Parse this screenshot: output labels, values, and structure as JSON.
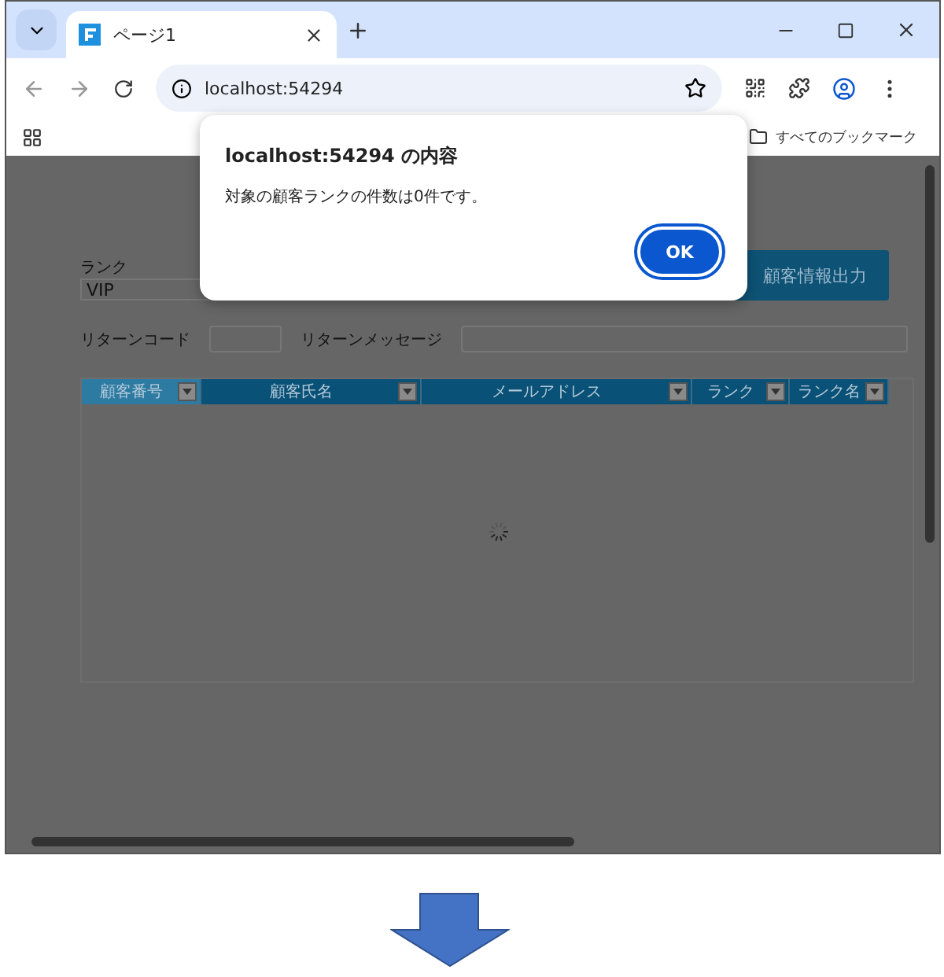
{
  "browser": {
    "tab_title": "ページ1",
    "address": "localhost:54294",
    "bookmarks_label": "すべてのブックマーク"
  },
  "form": {
    "rank_label": "ランク",
    "rank_value": "VIP",
    "export_button": "顧客情報出力",
    "return_code_label": "リターンコード",
    "return_message_label": "リターンメッセージ"
  },
  "grid": {
    "columns": [
      {
        "label": "顧客番号",
        "selected": true
      },
      {
        "label": "顧客氏名",
        "selected": false
      },
      {
        "label": "メールアドレス",
        "selected": false
      },
      {
        "label": "ランク",
        "selected": false
      },
      {
        "label": "ランク名",
        "selected": false
      }
    ],
    "loading": true
  },
  "dialog": {
    "title": "localhost:54294 の内容",
    "message": "対象の顧客ランクの件数は0件です。",
    "ok_button": "OK"
  }
}
